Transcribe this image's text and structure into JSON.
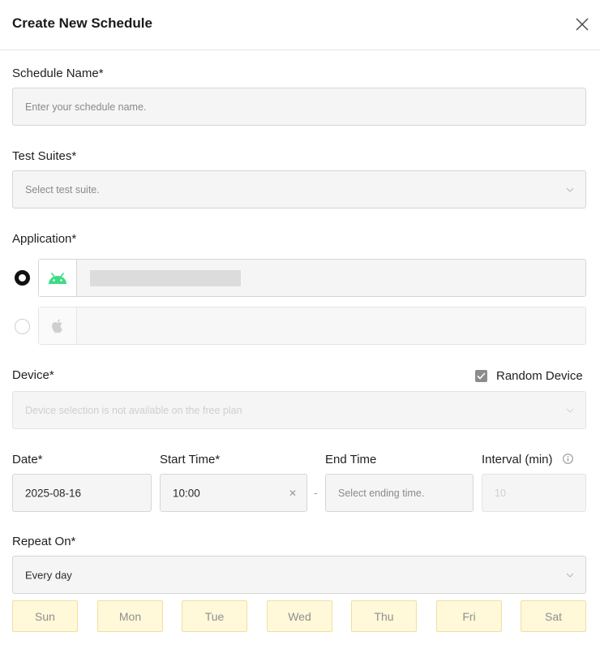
{
  "dialog": {
    "title": "Create New Schedule"
  },
  "schedule_name": {
    "label": "Schedule Name*",
    "placeholder": "Enter your schedule name."
  },
  "test_suites": {
    "label": "Test Suites*",
    "placeholder": "Select test suite."
  },
  "application": {
    "label": "Application*",
    "options": [
      {
        "platform": "android",
        "icon": "android-icon",
        "selected": true
      },
      {
        "platform": "ios",
        "icon": "apple-icon",
        "selected": false
      }
    ]
  },
  "device": {
    "label": "Device*",
    "placeholder": "Device selection is not available on the free plan",
    "random_device_label": "Random Device",
    "random_device_checked": true
  },
  "date": {
    "label": "Date*",
    "value": "2025-08-16"
  },
  "start_time": {
    "label": "Start Time*",
    "value": "10:00"
  },
  "time_separator": "-",
  "end_time": {
    "label": "End Time",
    "placeholder": "Select ending time."
  },
  "interval": {
    "label": "Interval (min)",
    "placeholder": "10"
  },
  "repeat_on": {
    "label": "Repeat On*",
    "value": "Every day",
    "days": [
      "Sun",
      "Mon",
      "Tue",
      "Wed",
      "Thu",
      "Fri",
      "Sat"
    ]
  },
  "colors": {
    "android_green": "#3ddc84",
    "day_bg": "#fff8d9",
    "day_border": "#f3dea0"
  }
}
